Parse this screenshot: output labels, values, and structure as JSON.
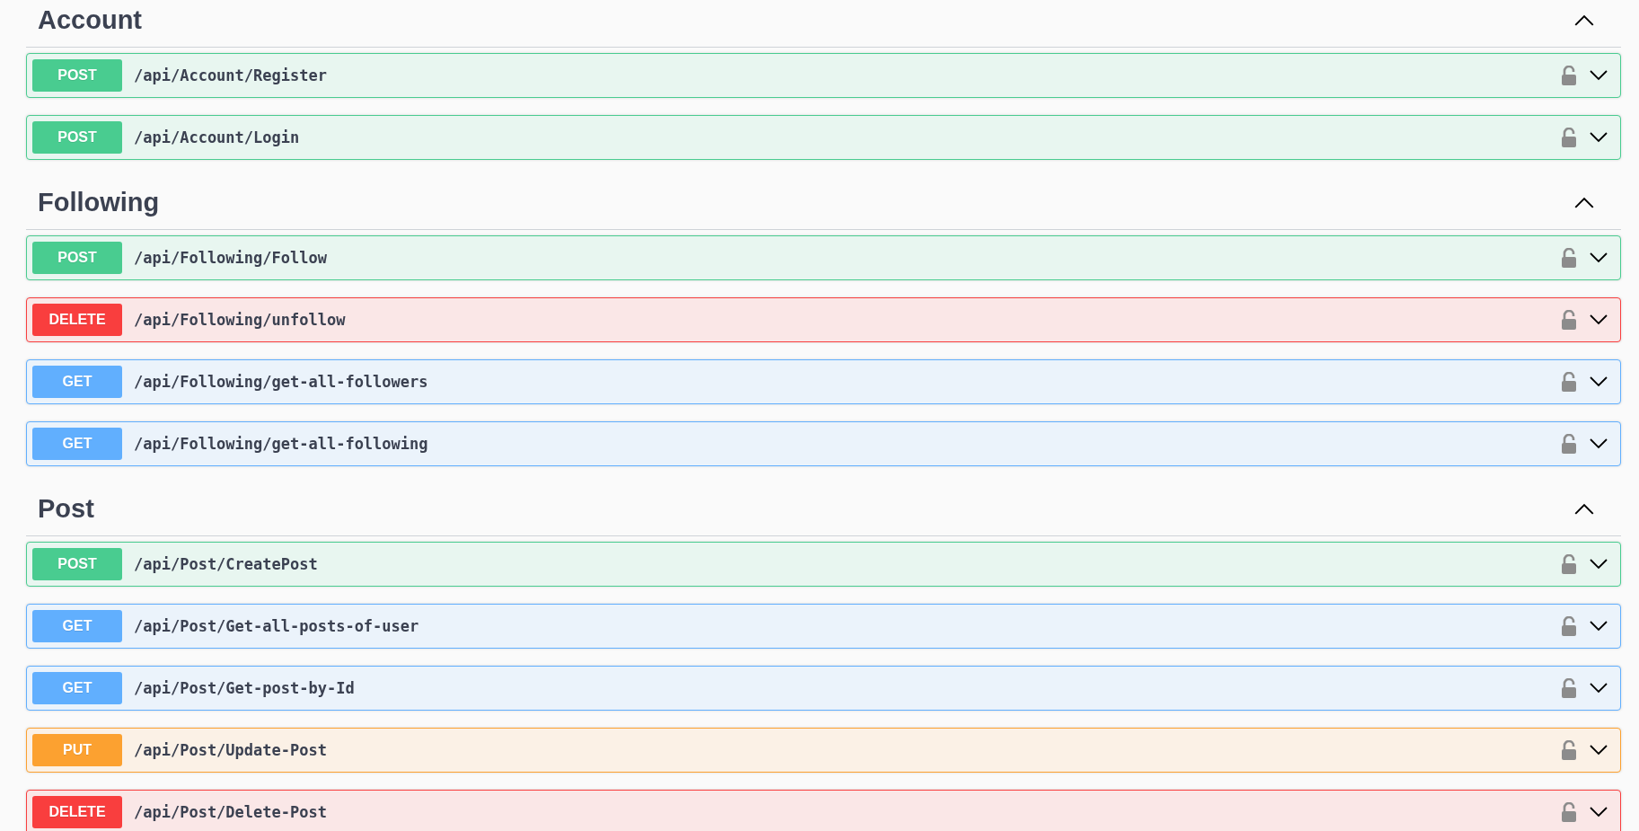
{
  "sections": [
    {
      "name": "Account",
      "expanded": true,
      "operations": [
        {
          "method": "POST",
          "path": "/api/Account/Register",
          "locked": false,
          "expanded": false
        },
        {
          "method": "POST",
          "path": "/api/Account/Login",
          "locked": false,
          "expanded": false
        }
      ]
    },
    {
      "name": "Following",
      "expanded": true,
      "operations": [
        {
          "method": "POST",
          "path": "/api/Following/Follow",
          "locked": false,
          "expanded": false
        },
        {
          "method": "DELETE",
          "path": "/api/Following/unfollow",
          "locked": false,
          "expanded": false
        },
        {
          "method": "GET",
          "path": "/api/Following/get-all-followers",
          "locked": false,
          "expanded": false
        },
        {
          "method": "GET",
          "path": "/api/Following/get-all-following",
          "locked": false,
          "expanded": false
        }
      ]
    },
    {
      "name": "Post",
      "expanded": true,
      "operations": [
        {
          "method": "POST",
          "path": "/api/Post/CreatePost",
          "locked": false,
          "expanded": false
        },
        {
          "method": "GET",
          "path": "/api/Post/Get-all-posts-of-user",
          "locked": false,
          "expanded": false
        },
        {
          "method": "GET",
          "path": "/api/Post/Get-post-by-Id",
          "locked": false,
          "expanded": false
        },
        {
          "method": "PUT",
          "path": "/api/Post/Update-Post",
          "locked": false,
          "expanded": false
        },
        {
          "method": "DELETE",
          "path": "/api/Post/Delete-Post",
          "locked": false,
          "expanded": false
        }
      ]
    }
  ]
}
